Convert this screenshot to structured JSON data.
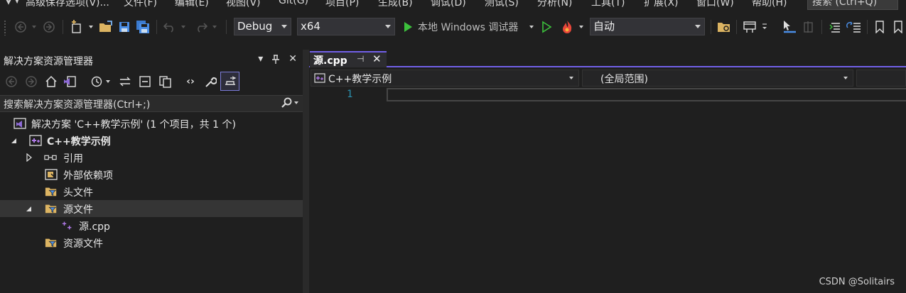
{
  "menu": {
    "items": [
      "高级保存选项(V)...",
      "文件(F)",
      "编辑(E)",
      "视图(V)",
      "Git(G)",
      "项目(P)",
      "生成(B)",
      "调试(D)",
      "测试(S)",
      "分析(N)",
      "工具(T)",
      "扩展(X)",
      "窗口(W)",
      "帮助(H)"
    ],
    "search": "搜索 (Ctrl+Q)"
  },
  "toolbar": {
    "config": "Debug",
    "platform": "x64",
    "run_label": "本地 Windows 调试器",
    "auto": "自动"
  },
  "solution_explorer": {
    "title": "解决方案资源管理器",
    "search_placeholder": "搜索解决方案资源管理器(Ctrl+;)",
    "tree": [
      {
        "label": "解决方案 'C++教学示例' (1 个项目，共 1 个)",
        "level": 0,
        "icon": "solution-icon"
      },
      {
        "label": "C++教学示例",
        "level": 0,
        "icon": "project-icon",
        "expanded": true,
        "bold": true
      },
      {
        "label": "引用",
        "level": 1,
        "icon": "reference-icon",
        "expandable": true
      },
      {
        "label": "外部依赖项",
        "level": 1,
        "icon": "external-deps-icon"
      },
      {
        "label": "头文件",
        "level": 1,
        "icon": "filter-folder-icon"
      },
      {
        "label": "源文件",
        "level": 1,
        "icon": "filter-folder-icon",
        "expanded": true,
        "selected": true
      },
      {
        "label": "源.cpp",
        "level": 2,
        "icon": "cpp-file-icon"
      },
      {
        "label": "资源文件",
        "level": 1,
        "icon": "filter-folder-icon"
      }
    ]
  },
  "editor": {
    "tab_name": "源.cpp",
    "nav_project": "C++教学示例",
    "nav_scope": "(全局范围)",
    "line_number": "1"
  },
  "watermark": "CSDN @Solitairs",
  "colors": {
    "accent": "#7160e8",
    "background": "#1f1f1f",
    "line_number": "#2b91af",
    "run_green": "#3cc03c",
    "folder_yellow": "#dcb462"
  }
}
